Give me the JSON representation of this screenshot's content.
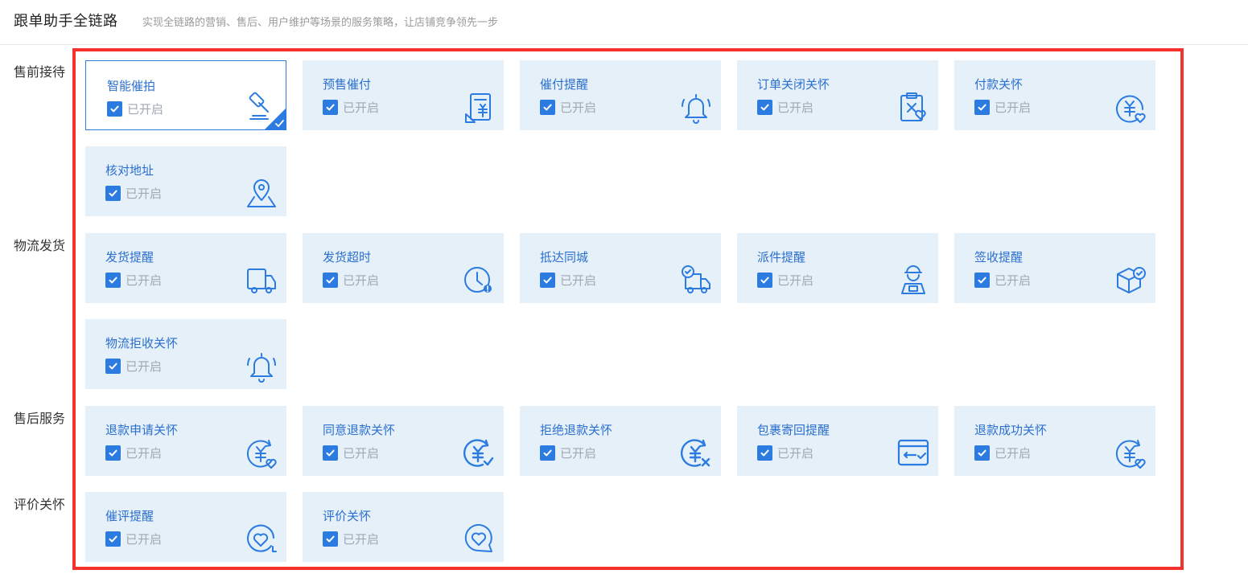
{
  "header": {
    "title": "跟单助手全链路",
    "subtitle": "实现全链路的营销、售后、用户维护等场景的服务策略，让店铺竞争领先一步"
  },
  "sections": [
    {
      "label": "售前接待",
      "cards": [
        {
          "title": "智能催拍",
          "status": "已开启",
          "checked": true,
          "icon": "gavel-icon",
          "selected": true
        },
        {
          "title": "预售催付",
          "status": "已开启",
          "checked": true,
          "icon": "presale-payment-icon"
        },
        {
          "title": "催付提醒",
          "status": "已开启",
          "checked": true,
          "icon": "bell-icon"
        },
        {
          "title": "订单关闭关怀",
          "status": "已开启",
          "checked": true,
          "icon": "order-closed-care-icon"
        },
        {
          "title": "付款关怀",
          "status": "已开启",
          "checked": true,
          "icon": "payment-care-icon"
        },
        {
          "title": "核对地址",
          "status": "已开启",
          "checked": true,
          "icon": "map-location-icon"
        }
      ]
    },
    {
      "label": "物流发货",
      "cards": [
        {
          "title": "发货提醒",
          "status": "已开启",
          "checked": true,
          "icon": "truck-icon"
        },
        {
          "title": "发货超时",
          "status": "已开启",
          "checked": true,
          "icon": "clock-alert-icon"
        },
        {
          "title": "抵达同城",
          "status": "已开启",
          "checked": true,
          "icon": "truck-arrived-icon"
        },
        {
          "title": "派件提醒",
          "status": "已开启",
          "checked": true,
          "icon": "courier-icon"
        },
        {
          "title": "签收提醒",
          "status": "已开启",
          "checked": true,
          "icon": "package-check-icon"
        },
        {
          "title": "物流拒收关怀",
          "status": "已开启",
          "checked": true,
          "icon": "bell-icon"
        }
      ]
    },
    {
      "label": "售后服务",
      "cards": [
        {
          "title": "退款申请关怀",
          "status": "已开启",
          "checked": true,
          "icon": "refund-care-icon"
        },
        {
          "title": "同意退款关怀",
          "status": "已开启",
          "checked": true,
          "icon": "refund-approved-icon"
        },
        {
          "title": "拒绝退款关怀",
          "status": "已开启",
          "checked": true,
          "icon": "refund-rejected-icon"
        },
        {
          "title": "包裹寄回提醒",
          "status": "已开启",
          "checked": true,
          "icon": "package-return-icon"
        },
        {
          "title": "退款成功关怀",
          "status": "已开启",
          "checked": true,
          "icon": "refund-success-icon"
        }
      ]
    },
    {
      "label": "评价关怀",
      "cards": [
        {
          "title": "催评提醒",
          "status": "已开启",
          "checked": true,
          "icon": "review-reminder-icon"
        },
        {
          "title": "评价关怀",
          "status": "已开启",
          "checked": true,
          "icon": "review-care-icon"
        }
      ]
    }
  ],
  "colors": {
    "accent": "#2b7be0",
    "card_bg": "#e6f0f9",
    "title_text": "#2b6fcf",
    "status_text": "#a0a8b4",
    "highlight_border": "#f5312e"
  }
}
